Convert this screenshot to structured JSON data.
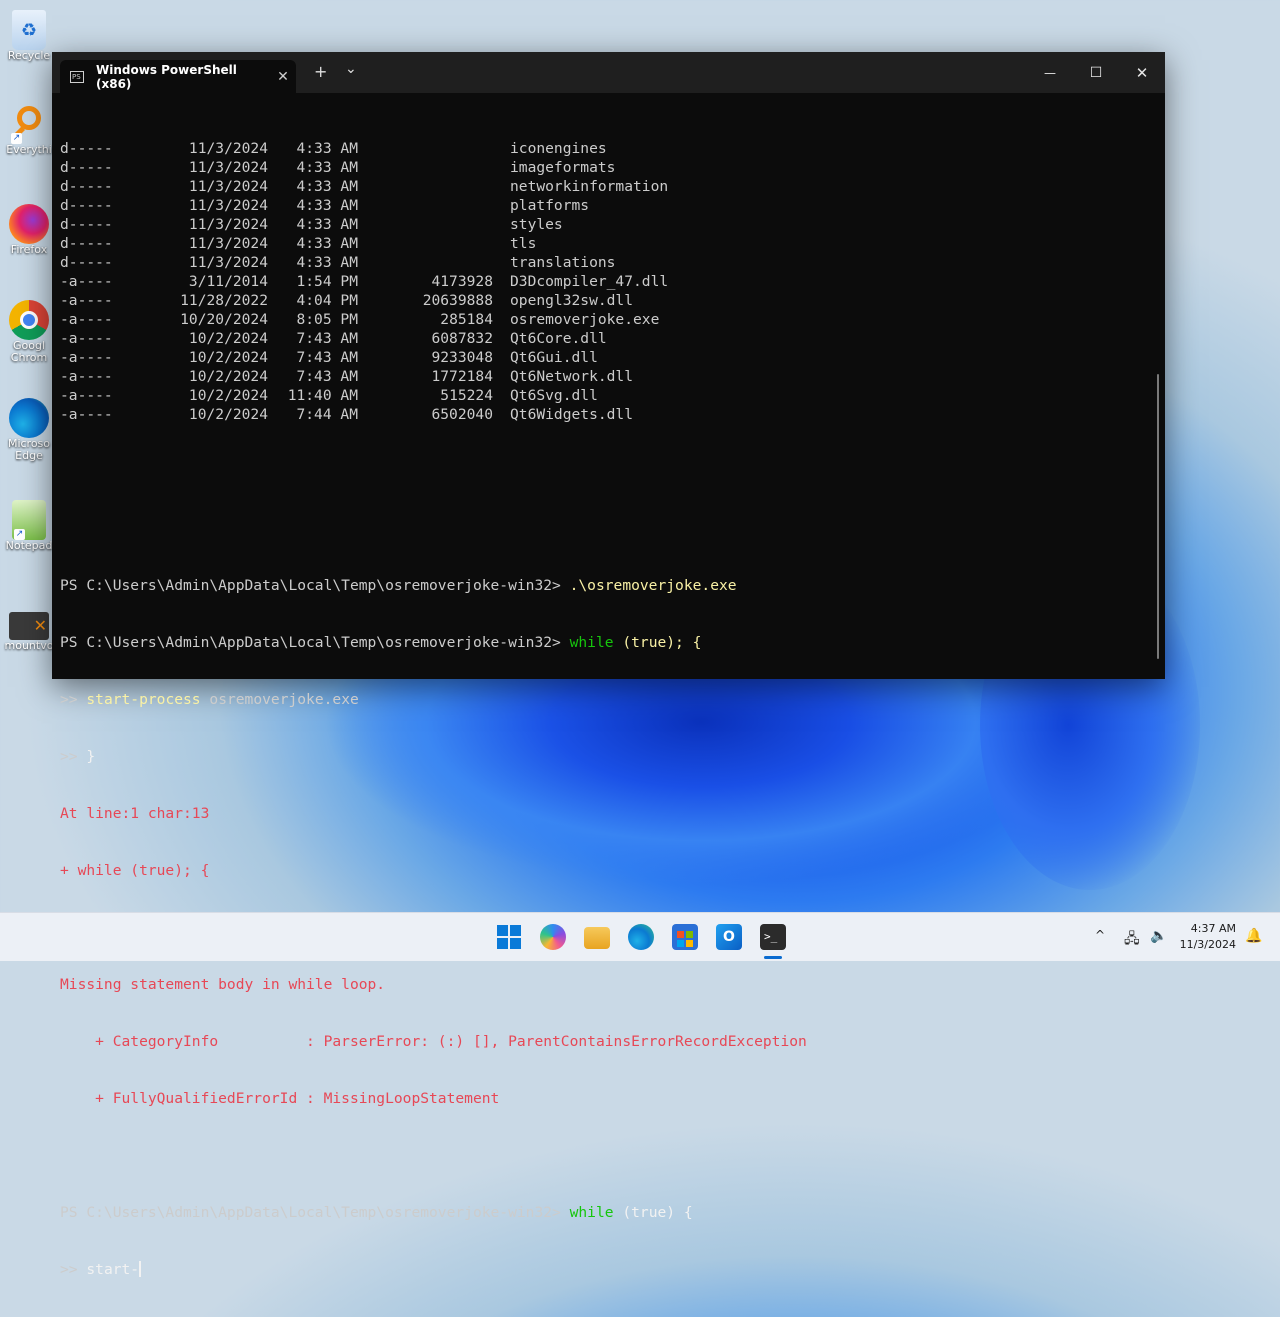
{
  "desktop_icons": [
    {
      "name": "recycle-bin",
      "label": "Recycle"
    },
    {
      "name": "everything",
      "label": "Everythi"
    },
    {
      "name": "firefox",
      "label": "Firefox"
    },
    {
      "name": "google-chrome",
      "label": "Googl Chrom"
    },
    {
      "name": "microsoft-edge",
      "label": "Microso Edge"
    },
    {
      "name": "notepad",
      "label": "Notepad"
    },
    {
      "name": "mountvol",
      "label": "mountvo"
    }
  ],
  "terminal": {
    "tab_title": "Windows PowerShell (x86)",
    "tab_icon_text": "PS",
    "new_tab": "+",
    "dropdown": "⌄",
    "close_tab": "✕",
    "minimize": "—",
    "maximize": "☐",
    "close": "✕",
    "listing": [
      {
        "mode": "d-----",
        "date": "11/3/2024",
        "time": "4:33 AM",
        "length": "",
        "name": "iconengines"
      },
      {
        "mode": "d-----",
        "date": "11/3/2024",
        "time": "4:33 AM",
        "length": "",
        "name": "imageformats"
      },
      {
        "mode": "d-----",
        "date": "11/3/2024",
        "time": "4:33 AM",
        "length": "",
        "name": "networkinformation"
      },
      {
        "mode": "d-----",
        "date": "11/3/2024",
        "time": "4:33 AM",
        "length": "",
        "name": "platforms"
      },
      {
        "mode": "d-----",
        "date": "11/3/2024",
        "time": "4:33 AM",
        "length": "",
        "name": "styles"
      },
      {
        "mode": "d-----",
        "date": "11/3/2024",
        "time": "4:33 AM",
        "length": "",
        "name": "tls"
      },
      {
        "mode": "d-----",
        "date": "11/3/2024",
        "time": "4:33 AM",
        "length": "",
        "name": "translations"
      },
      {
        "mode": "-a----",
        "date": "3/11/2014",
        "time": "1:54 PM",
        "length": "4173928",
        "name": "D3Dcompiler_47.dll"
      },
      {
        "mode": "-a----",
        "date": "11/28/2022",
        "time": "4:04 PM",
        "length": "20639888",
        "name": "opengl32sw.dll"
      },
      {
        "mode": "-a----",
        "date": "10/20/2024",
        "time": "8:05 PM",
        "length": "285184",
        "name": "osremoverjoke.exe"
      },
      {
        "mode": "-a----",
        "date": "10/2/2024",
        "time": "7:43 AM",
        "length": "6087832",
        "name": "Qt6Core.dll"
      },
      {
        "mode": "-a----",
        "date": "10/2/2024",
        "time": "7:43 AM",
        "length": "9233048",
        "name": "Qt6Gui.dll"
      },
      {
        "mode": "-a----",
        "date": "10/2/2024",
        "time": "7:43 AM",
        "length": "1772184",
        "name": "Qt6Network.dll"
      },
      {
        "mode": "-a----",
        "date": "10/2/2024",
        "time": "11:40 AM",
        "length": "515224",
        "name": "Qt6Svg.dll"
      },
      {
        "mode": "-a----",
        "date": "10/2/2024",
        "time": "7:44 AM",
        "length": "6502040",
        "name": "Qt6Widgets.dll"
      }
    ],
    "prompt": "PS C:\\Users\\Admin\\AppData\\Local\\Temp\\osremoverjoke-win32>",
    "cmd1": ".\\osremoverjoke.exe",
    "cmd2_kw": "while",
    "cmd2_rest": "(true); {",
    "cont_prompt": ">>",
    "cmd3_a": "start-process",
    "cmd3_b": "osremoverjoke.exe",
    "cmd4": "}",
    "err1": "At line:1 char:13",
    "err2": "+ while (true); {",
    "err3": "+             ~",
    "err4": "Missing statement body in while loop.",
    "err5_a": "    + CategoryInfo          : ParserError: (:) [], ParentContainsErrorRecordException",
    "err6_a": "    + FullyQualifiedErrorId : MissingLoopStatement",
    "cmd5_kw": "while",
    "cmd5_rest": "(true) {",
    "cmd6": "start-"
  },
  "taskbar": {
    "time": "4:37 AM",
    "date": "11/3/2024",
    "tray_chevron": "^"
  }
}
